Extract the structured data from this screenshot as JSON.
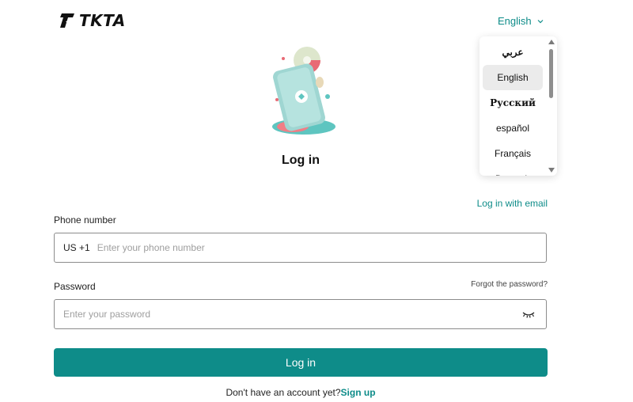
{
  "brand": {
    "name": "TKTA",
    "accent": "#0e8c89"
  },
  "language": {
    "current": "English",
    "options": [
      {
        "label": "عربي"
      },
      {
        "label": "English",
        "selected": true
      },
      {
        "label": "Русский"
      },
      {
        "label": "español"
      },
      {
        "label": "Français"
      },
      {
        "label": "Deutsch"
      }
    ]
  },
  "page": {
    "title": "Log in"
  },
  "links": {
    "email_login": "Log in with email",
    "forgot_password": "Forgot the password?"
  },
  "phone": {
    "label": "Phone number",
    "country_prefix": "US +1",
    "placeholder": "Enter your phone number"
  },
  "password": {
    "label": "Password",
    "placeholder": "Enter your password"
  },
  "actions": {
    "login_button": "Log in"
  },
  "signup": {
    "prompt": "Don't have an account yet?",
    "link": "Sign up"
  },
  "icons": [
    "logo-icon",
    "chevron-down-icon",
    "eye-closed-icon",
    "scroll-up-icon",
    "scroll-down-icon"
  ]
}
